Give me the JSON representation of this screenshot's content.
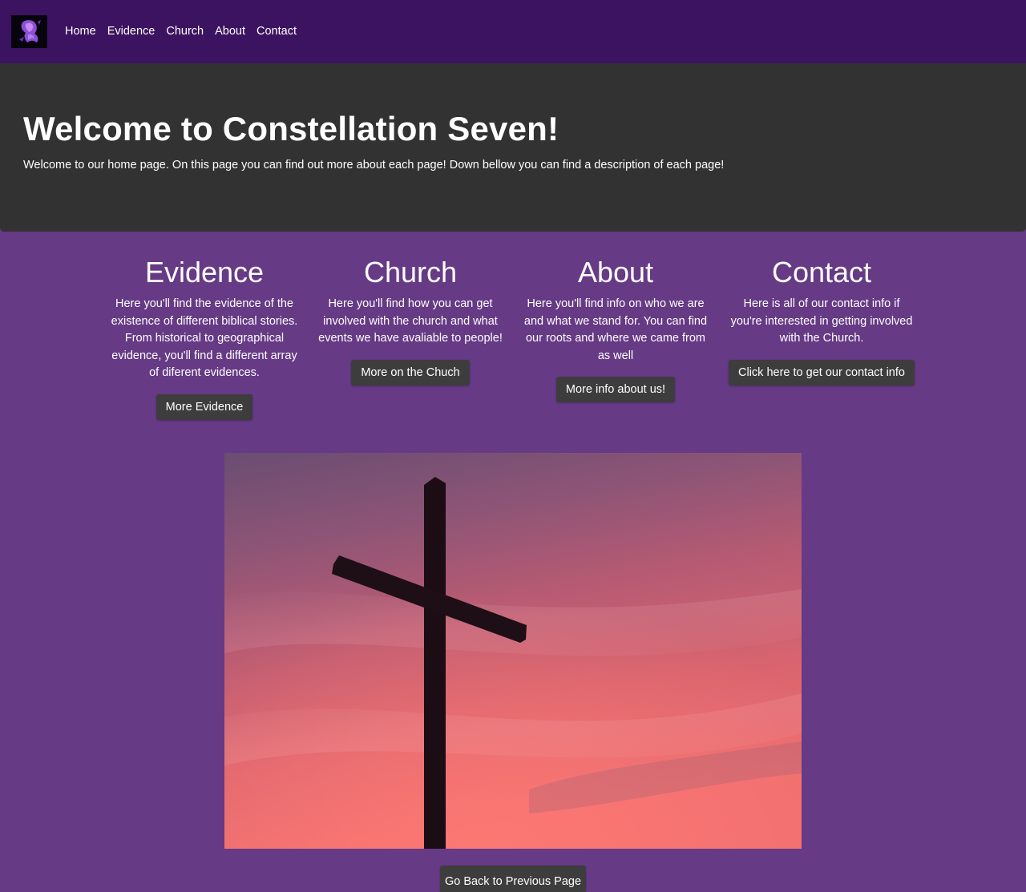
{
  "colors": {
    "navbar_bg": "#3c1361",
    "hero_bg": "#323232",
    "page_bg": "#663a85",
    "button_bg": "#3d3d3d",
    "text": "#ffffff"
  },
  "navbar": {
    "logo_icon": "purple-crest-icon",
    "links": [
      "Home",
      "Evidence",
      "Church",
      "About",
      "Contact"
    ]
  },
  "hero": {
    "title": "Welcome to Constellation Seven!",
    "subtitle": "Welcome to our home page. On this page you can find out more about each page! Down bellow you can find a description of each page!"
  },
  "sections": [
    {
      "heading": "Evidence",
      "text": "Here you'll find the evidence of the existence of different biblical stories. From historical to geographical evidence, you'll find a different array of diferent evidences.",
      "button": "More Evidence"
    },
    {
      "heading": "Church",
      "text": "Here you'll find how you can get involved with the church and what events we have avaliable to people!",
      "button": "More on the Chuch"
    },
    {
      "heading": "About",
      "text": "Here you'll find info on who we are and what we stand for. You can find our roots and where we came from as well",
      "button": "More info about us!"
    },
    {
      "heading": "Contact",
      "text": "Here is all of our contact info if you're interested in getting involved with the Church.",
      "button": "Click here to get our contact info"
    }
  ],
  "image": {
    "subject": "cross-silhouette-sunset"
  },
  "footer": {
    "back_button": "Go Back to Previous Page"
  }
}
